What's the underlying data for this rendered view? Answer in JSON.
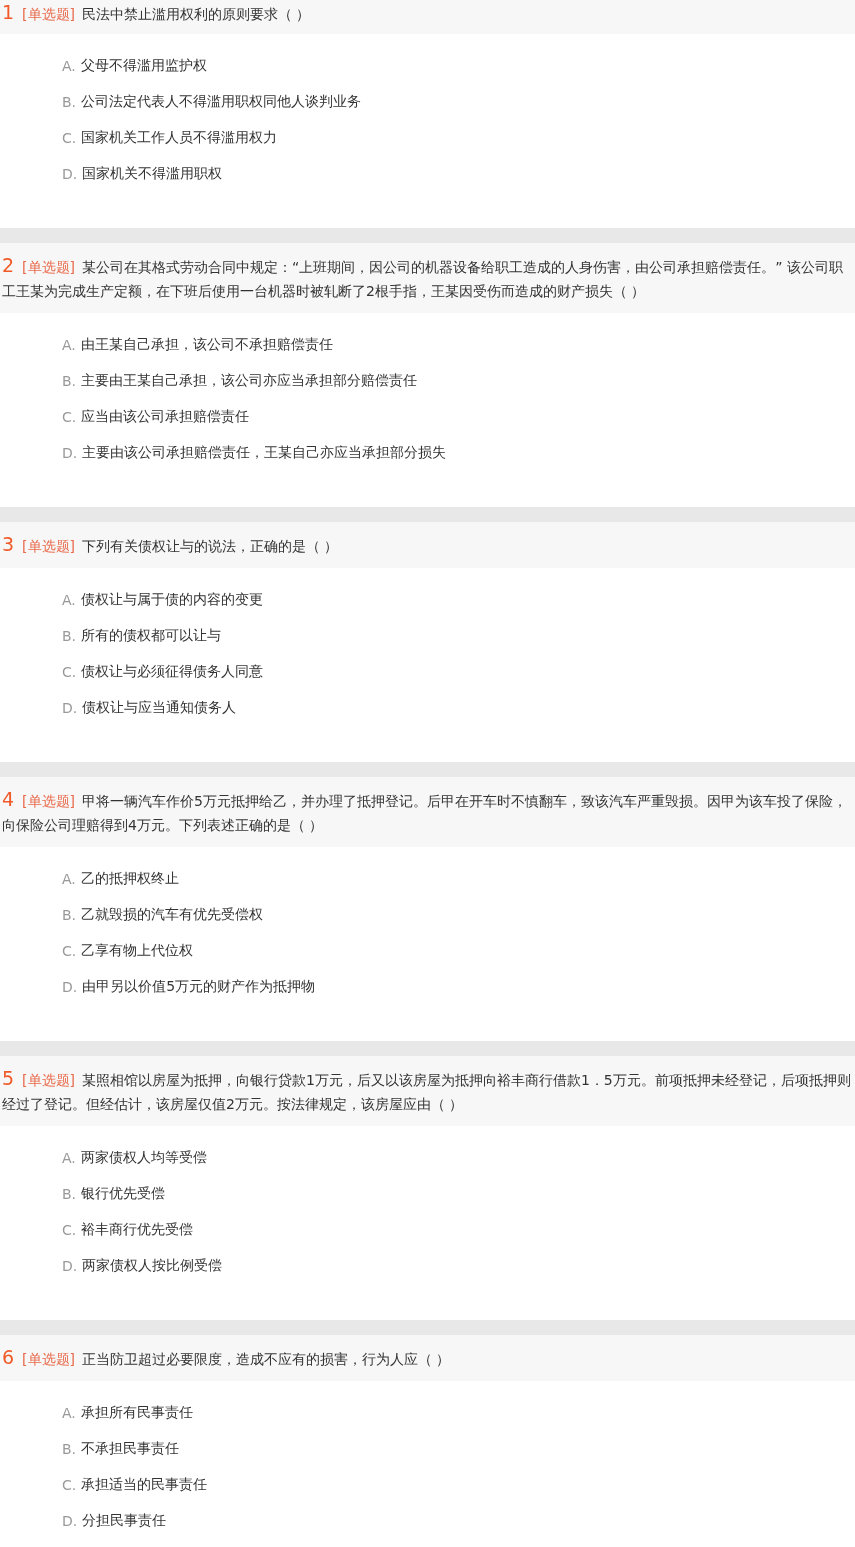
{
  "questions": [
    {
      "number": "1",
      "type": "[单选题]",
      "text": "民法中禁止滥用权利的原则要求（ ）",
      "options": [
        {
          "letter": "A.",
          "text": "父母不得滥用监护权"
        },
        {
          "letter": "B.",
          "text": "公司法定代表人不得滥用职权同他人谈判业务"
        },
        {
          "letter": "C.",
          "text": "国家机关工作人员不得滥用权力"
        },
        {
          "letter": "D.",
          "text": "国家机关不得滥用职权"
        }
      ]
    },
    {
      "number": "2",
      "type": "[单选题]",
      "text": "某公司在其格式劳动合同中规定：“上班期间，因公司的机器设备给职工造成的人身伤害，由公司承担赔偿责任。” 该公司职工王某为完成生产定额，在下班后使用一台机器时被轧断了2根手指，王某因受伤而造成的财产损失（ ）",
      "options": [
        {
          "letter": "A.",
          "text": "由王某自己承担，该公司不承担赔偿责任"
        },
        {
          "letter": "B.",
          "text": "主要由王某自己承担，该公司亦应当承担部分赔偿责任"
        },
        {
          "letter": "C.",
          "text": "应当由该公司承担赔偿责任"
        },
        {
          "letter": "D.",
          "text": "主要由该公司承担赔偿责任，王某自己亦应当承担部分损失"
        }
      ]
    },
    {
      "number": "3",
      "type": "[单选题]",
      "text": "下列有关债权让与的说法，正确的是（ ）",
      "options": [
        {
          "letter": "A.",
          "text": "债权让与属于债的内容的变更"
        },
        {
          "letter": "B.",
          "text": "所有的债权都可以让与"
        },
        {
          "letter": "C.",
          "text": "债权让与必须征得债务人同意"
        },
        {
          "letter": "D.",
          "text": "债权让与应当通知债务人"
        }
      ]
    },
    {
      "number": "4",
      "type": "[单选题]",
      "text": "甲将一辆汽车作价5万元抵押给乙，并办理了抵押登记。后甲在开车时不慎翻车，致该汽车严重毁损。因甲为该车投了保险，向保险公司理赔得到4万元。下列表述正确的是（ ）",
      "options": [
        {
          "letter": "A.",
          "text": "乙的抵押权终止"
        },
        {
          "letter": "B.",
          "text": "乙就毁损的汽车有优先受偿权"
        },
        {
          "letter": "C.",
          "text": "乙享有物上代位权"
        },
        {
          "letter": "D.",
          "text": "由甲另以价值5万元的财产作为抵押物"
        }
      ]
    },
    {
      "number": "5",
      "type": "[单选题]",
      "text": "某照相馆以房屋为抵押，向银行贷款1万元，后又以该房屋为抵押向裕丰商行借款1．5万元。前项抵押未经登记，后项抵押则经过了登记。但经估计，该房屋仅值2万元。按法律规定，该房屋应由（ ）",
      "options": [
        {
          "letter": "A.",
          "text": "两家债权人均等受偿"
        },
        {
          "letter": "B.",
          "text": "银行优先受偿"
        },
        {
          "letter": "C.",
          "text": "裕丰商行优先受偿"
        },
        {
          "letter": "D.",
          "text": "两家债权人按比例受偿"
        }
      ]
    },
    {
      "number": "6",
      "type": "[单选题]",
      "text": "正当防卫超过必要限度，造成不应有的损害，行为人应（ ）",
      "options": [
        {
          "letter": "A.",
          "text": "承担所有民事责任"
        },
        {
          "letter": "B.",
          "text": "不承担民事责任"
        },
        {
          "letter": "C.",
          "text": "承担适当的民事责任"
        },
        {
          "letter": "D.",
          "text": "分担民事责任"
        }
      ]
    }
  ]
}
